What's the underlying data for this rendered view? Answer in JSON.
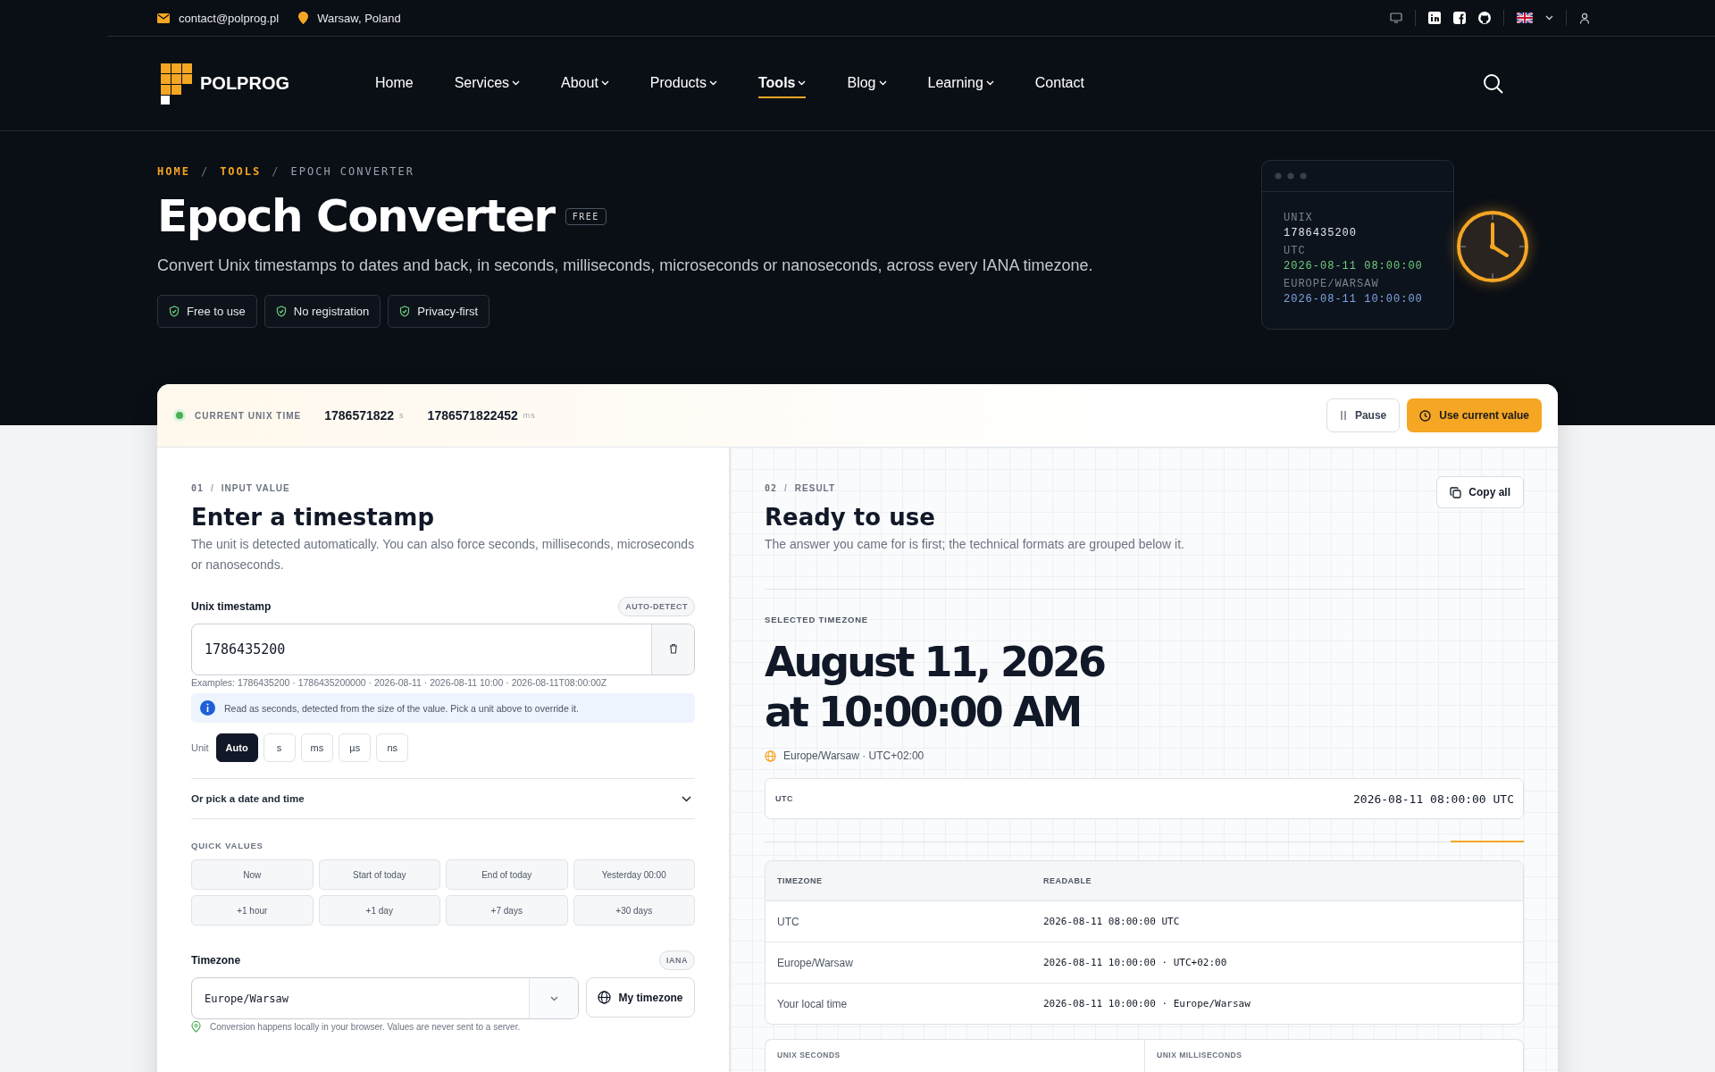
{
  "topbar": {
    "email": "contact@polprog.pl",
    "location": "Warsaw, Poland"
  },
  "nav": {
    "logo": "POLPROG",
    "items": [
      {
        "label": "Home",
        "dropdown": false,
        "selected": false
      },
      {
        "label": "Services",
        "dropdown": true,
        "selected": false
      },
      {
        "label": "About",
        "dropdown": true,
        "selected": false
      },
      {
        "label": "Products",
        "dropdown": true,
        "selected": false
      },
      {
        "label": "Tools",
        "dropdown": true,
        "selected": true
      },
      {
        "label": "Blog",
        "dropdown": true,
        "selected": false
      },
      {
        "label": "Learning",
        "dropdown": true,
        "selected": false
      },
      {
        "label": "Contact",
        "dropdown": false,
        "selected": false
      }
    ]
  },
  "hero": {
    "separator": "/",
    "breadcrumb": [
      {
        "label": "HOME",
        "link": true
      },
      {
        "label": "TOOLS",
        "link": true
      },
      {
        "label": "EPOCH CONVERTER",
        "link": false
      }
    ],
    "title": "Epoch Converter",
    "badge": "FREE",
    "subtitle": "Convert Unix timestamps to dates and back, in seconds, milliseconds, microseconds or nanoseconds, across every IANA timezone.",
    "features": [
      "Free to use",
      "No registration",
      "Privacy-first"
    ],
    "preview": [
      {
        "label": "UNIX",
        "value": "1786435200",
        "color": "#e5e7eb"
      },
      {
        "label": "UTC",
        "value": "2026-08-11 08:00:00",
        "color": "#6fcf7f"
      },
      {
        "label": "EUROPE/WARSAW",
        "value": "2026-08-11 10:00:00",
        "color": "#7fa6e6"
      }
    ]
  },
  "live": {
    "label": "CURRENT UNIX TIME",
    "seconds": "1786571822",
    "seconds_unit": "s",
    "millis": "1786571822452",
    "millis_unit": "ms",
    "pause": "Pause",
    "use": "Use current value"
  },
  "input": {
    "step": "01",
    "step_separator": "/",
    "step_label": "INPUT VALUE",
    "title": "Enter a timestamp",
    "description": "The unit is detected automatically. You can also force seconds, milliseconds, microseconds or nanoseconds.",
    "field_label": "Unix timestamp",
    "field_badge": "AUTO-DETECT",
    "value": "1786435200",
    "examples": "Examples: 1786435200 · 1786435200000 · 2026-08-11 · 2026-08-11 10:00 · 2026-08-11T08:00:00Z",
    "info": "Read as seconds, detected from the size of the value. Pick a unit above to override it.",
    "unit_label": "Unit",
    "units": [
      {
        "label": "Auto",
        "selected": true
      },
      {
        "label": "s",
        "selected": false
      },
      {
        "label": "ms",
        "selected": false
      },
      {
        "label": "µs",
        "selected": false
      },
      {
        "label": "ns",
        "selected": false
      }
    ],
    "picker": {
      "label": "Or pick a date and time",
      "expanded": false
    },
    "quick_label": "QUICK VALUES",
    "quick": [
      "Now",
      "Start of today",
      "End of today",
      "Yesterday 00:00",
      "+1 hour",
      "+1 day",
      "+7 days",
      "+30 days"
    ],
    "tz_label": "Timezone",
    "tz_badge": "IANA",
    "timezone": "Europe/Warsaw",
    "my_tz": "My timezone",
    "note": "Conversion happens locally in your browser. Values are never sent to a server."
  },
  "result": {
    "step": "02",
    "step_separator": "/",
    "step_label": "RESULT",
    "title": "Ready to use",
    "copy": "Copy all",
    "description": "The answer you came for is first; the technical formats are grouped below it.",
    "selected_label": "SELECTED TIMEZONE",
    "date_line": "August 11, 2026",
    "time_line": "at 10:00:00 AM",
    "zone": "Europe/Warsaw · UTC+02:00",
    "utc_label": "UTC",
    "utc_value": "2026-08-11 08:00:00 UTC",
    "table": {
      "columns": [
        "TIMEZONE",
        "READABLE"
      ],
      "rows": [
        [
          "UTC",
          "2026-08-11 08:00:00 UTC"
        ],
        [
          "Europe/Warsaw",
          "2026-08-11 10:00:00 · UTC+02:00"
        ],
        [
          "Your local time",
          "2026-08-11 10:00:00 · Europe/Warsaw"
        ]
      ]
    },
    "formats": [
      "UNIX SECONDS",
      "UNIX MILLISECONDS"
    ]
  }
}
